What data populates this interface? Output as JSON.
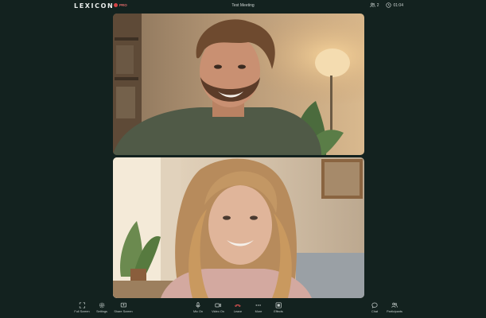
{
  "header": {
    "logo_text": "LEXICON",
    "pro_label": "PRO",
    "meeting_title": "Test Meeting",
    "participants_count": "2",
    "timer": "01:04"
  },
  "videos": [
    {
      "participant": "male-participant",
      "description_icon": "video-tile"
    },
    {
      "participant": "female-participant",
      "description_icon": "video-tile"
    }
  ],
  "toolbar": {
    "left": [
      {
        "label": "Full Screen",
        "icon": "fullscreen-icon"
      },
      {
        "label": "Settings",
        "icon": "gear-icon"
      },
      {
        "label": "Share Screen",
        "icon": "share-screen-icon"
      }
    ],
    "center": [
      {
        "label": "Mic On",
        "icon": "microphone-icon"
      },
      {
        "label": "Video On",
        "icon": "video-camera-icon"
      },
      {
        "label": "Leave",
        "icon": "phone-hangup-icon"
      },
      {
        "label": "More",
        "icon": "more-dots-icon"
      },
      {
        "label": "Effects",
        "icon": "effects-icon"
      }
    ],
    "right": [
      {
        "label": "Chat",
        "icon": "chat-icon"
      },
      {
        "label": "Participants",
        "icon": "participants-icon"
      }
    ]
  },
  "colors": {
    "background": "#13221f",
    "leave_accent": "#e05353",
    "pro_accent": "#d64545"
  }
}
